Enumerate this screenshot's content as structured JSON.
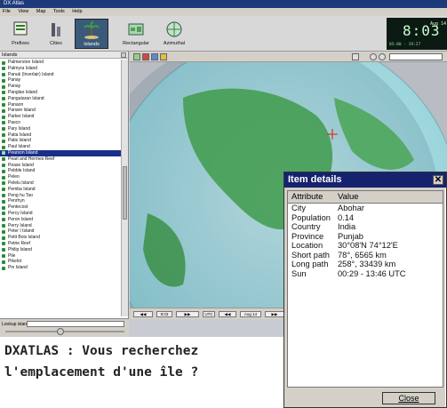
{
  "app": {
    "title": "DX Atlas"
  },
  "menu": [
    "File",
    "View",
    "Map",
    "Tools",
    "Help"
  ],
  "toolbar": [
    {
      "label": "Prefixes",
      "icon": "prefixes-icon"
    },
    {
      "label": "Cities",
      "icon": "cities-icon"
    },
    {
      "label": "Islands",
      "icon": "islands-icon"
    },
    {
      "label": "Rectangular",
      "icon": "rectangular-icon"
    },
    {
      "label": "Azimuthal",
      "icon": "azimuthal-icon"
    }
  ],
  "clock": {
    "time": "8:03",
    "date": "Aug 14",
    "sun": "05:00 - 19:27"
  },
  "list": {
    "header": "Islands",
    "items": [
      "Palmerston Island",
      "Palmyra Island",
      "Panuk (Inverlair) Island",
      "Panay",
      "Panay",
      "Panglao Island",
      "Pangutaran Island",
      "Panaon",
      "Panare Island",
      "Parker Island",
      "Pasco",
      "Pary Island",
      "Patia Island",
      "Patis Island",
      "Paul Island",
      "Pearson Island",
      "Pearl and Hermes Reef",
      "Pease Island",
      "Pebble Island",
      "Peleo",
      "Pelelu Island",
      "Pemba Island",
      "Peng hu Tao",
      "Penrhyn",
      "Pentecost",
      "Percy Island",
      "Peron Island",
      "Perry Island",
      "Peter I Island",
      "Petit Bois Island",
      "Petrie Reef",
      "Philip Island",
      "Pile",
      "Pikelot",
      "Pin Island"
    ],
    "selected_index": 15,
    "lookup_label": "Lookup island"
  },
  "bottombar": {
    "time": "8:03",
    "utc": "UTC",
    "date": "Aug 14"
  },
  "details": {
    "title": "Item details",
    "col_attr": "Attribute",
    "col_value": "Value",
    "rows": [
      {
        "k": "City",
        "v": "Abohar"
      },
      {
        "k": "Population",
        "v": "0.14"
      },
      {
        "k": "Country",
        "v": "India"
      },
      {
        "k": "Province",
        "v": "Punjab"
      },
      {
        "k": "Location",
        "v": "30°08'N  74°12'E"
      },
      {
        "k": "Short path",
        "v": "78°, 6565 km"
      },
      {
        "k": "Long path",
        "v": "258°, 33439 km"
      },
      {
        "k": "Sun",
        "v": "00:29 - 13:46 UTC"
      }
    ],
    "close_label": "Close"
  },
  "caption": "DXATLAS : Vous recherchez l'emplacement d'une île ?"
}
